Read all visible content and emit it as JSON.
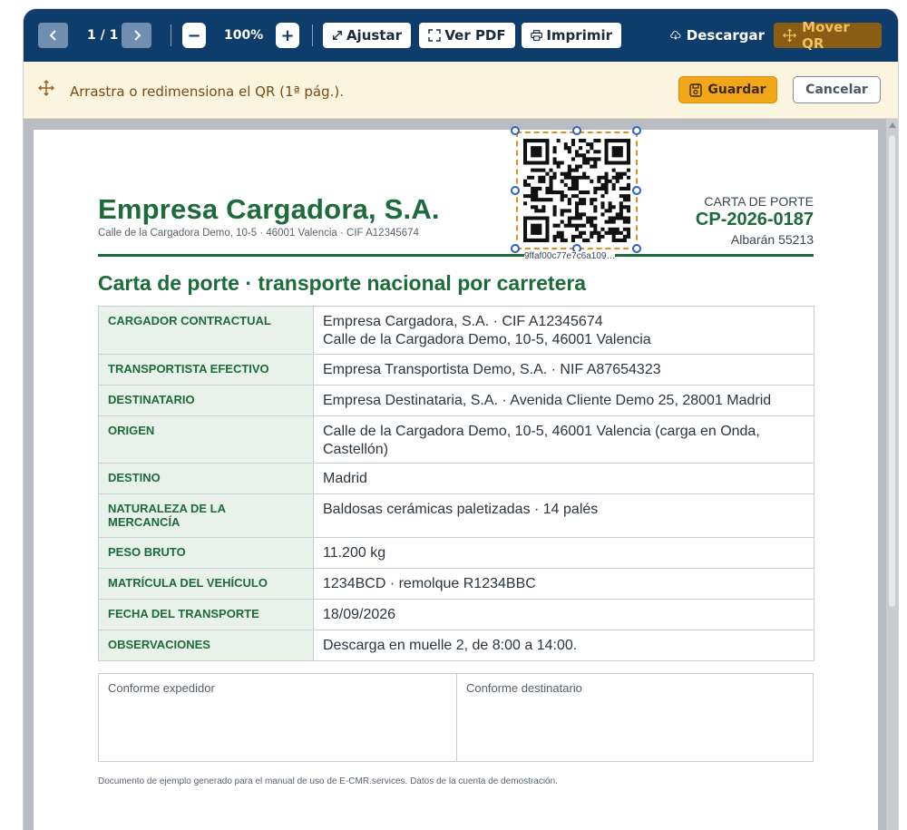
{
  "toolbar": {
    "prev_icon": "chevron-left-icon",
    "next_icon": "chevron-right-icon",
    "page_indicator": "1 / 1",
    "zoom_out": "−",
    "zoom_level": "100%",
    "zoom_in": "+",
    "fit_label": "Ajustar",
    "view_pdf_label": "Ver PDF",
    "print_label": "Imprimir",
    "download_label": "Descargar",
    "move_qr_label": "Mover QR"
  },
  "notice": {
    "text": "Arrastra o redimensiona el QR (1ª pág.).",
    "save_label": "Guardar",
    "cancel_label": "Cancelar"
  },
  "document": {
    "company": "Empresa Cargadora, S.A.",
    "address": "Calle de la Cargadora Demo, 10-5 · 46001 Valencia · CIF A12345674",
    "doc_type": "CARTA DE PORTE",
    "doc_number": "CP-2026-0187",
    "albaran": "Albarán 55213",
    "title": "Carta de porte · transporte nacional por carretera",
    "qr_caption": "9ffaf00c77e7c6a109…",
    "fields": [
      {
        "label": "CARGADOR CONTRACTUAL",
        "value": "Empresa Cargadora, S.A. · CIF A12345674",
        "value2": "Calle de la Cargadora Demo, 10-5, 46001 Valencia"
      },
      {
        "label": "TRANSPORTISTA EFECTIVO",
        "value": "Empresa Transportista Demo, S.A. · NIF A87654323"
      },
      {
        "label": "DESTINATARIO",
        "value": "Empresa Destinataria, S.A. · Avenida Cliente Demo 25, 28001 Madrid"
      },
      {
        "label": "ORIGEN",
        "value": "Calle de la Cargadora Demo, 10-5, 46001 Valencia (carga en Onda,",
        "value2": "Castellón)"
      },
      {
        "label": "DESTINO",
        "value": "Madrid"
      },
      {
        "label": "NATURALEZA DE LA",
        "label2": "MERCANCÍA",
        "value": "Baldosas cerámicas paletizadas · 14 palés"
      },
      {
        "label": "PESO BRUTO",
        "value": "11.200 kg"
      },
      {
        "label": "MATRÍCULA DEL VEHÍCULO",
        "value": "1234BCD · remolque R1234BBC"
      },
      {
        "label": "FECHA DEL TRANSPORTE",
        "value": "18/09/2026"
      },
      {
        "label": "OBSERVACIONES",
        "value": "Descarga en muelle 2, de 8:00 a 14:00."
      }
    ],
    "sign_shipper": "Conforme expedidor",
    "sign_consignee": "Conforme destinatario",
    "footnote": "Documento de ejemplo generado para el manual de uso de E-CMR.services. Datos de la cuenta de demostración."
  },
  "colors": {
    "toolbar_bg": "#0f3d6b",
    "brand_green": "#1d6b3a",
    "save_orange": "#f2a71b",
    "move_qr_bg": "#8a5d14"
  }
}
